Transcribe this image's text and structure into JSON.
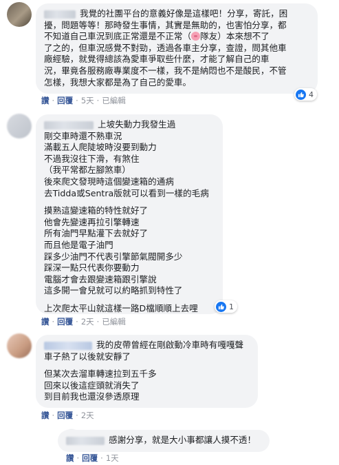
{
  "comments": [
    {
      "lines": [
        "我覺的社團平台的意義好像是這樣吧！分享，寄託，困",
        "擾，問題等等！那時發生事情，其實是無助的，也害怕分享，都",
        "不知道自己車況到底正常還是不正常（",
        "）本來想不了",
        "了之的，但車況感覺不對勁，透過各車主分享，查證，問其他車",
        "廠經驗，就覺得總該為愛車爭取些什麼，才能了解自己的車",
        "況，畢竟各服務廠專業度不一樣，我不是納悶也不是酸民，不管",
        "怎樣，我想大家都是為了自己的愛車。"
      ],
      "pig_label": "隊友",
      "actions": {
        "like": "讚",
        "reply": "回覆",
        "time": "5天",
        "edited": "已編輯"
      },
      "reaction_count": "4"
    },
    {
      "lines": [
        "上坡失動力我發生過",
        "剛交車時還不熟車況",
        "滿載五人爬陡坡時沒要到動力",
        "不過我沒往下滑，有煞住",
        "（我平常都左腳煞車）",
        "後來爬文發現時這個變速箱的通病",
        "去Tidda或Sentra版就可以看到一樣的毛病",
        "",
        "摸熟這變速箱的特性就好了",
        "他會先變速再拉引擎轉速",
        "所有油門早點灌下去就好了",
        "而且他是電子油門",
        "踩多少油門不代表引擎節氣閥開多少",
        "踩深一點只代表你要動力",
        "電腦才會去跟變速箱跟引擎說",
        "這多開一會兒就可以約略抓到特性了",
        "",
        "上次爬太平山就這樣一路D檔順順上去哩"
      ],
      "actions": {
        "like": "讚",
        "reply": "回覆",
        "time": "2天",
        "edited": "已編輯"
      },
      "reaction_count": "1"
    },
    {
      "lines": [
        "我的皮帶曾經在剛啟動冷車時有嘎嘎聲",
        "車子熱了以後就安靜了",
        "",
        "但某次去溜車轉速拉到五千多",
        "回來以後這症頭就消失了",
        "到目前我也還沒參透原理"
      ],
      "actions": {
        "like": "讚",
        "reply": "回覆",
        "time": "2天"
      }
    },
    {
      "lines": [
        "感謝分享，就是大小事都讓人摸不透！"
      ],
      "actions": {
        "like": "讚",
        "reply": "回覆",
        "time": "1天"
      }
    }
  ],
  "colors": {
    "bubble": "#f2f3f5",
    "action": "#385898",
    "meta": "#90949c",
    "like": "#1877f2"
  },
  "icons": {
    "like": "thumbs-up-icon",
    "pig": "pig-face-emoji"
  }
}
